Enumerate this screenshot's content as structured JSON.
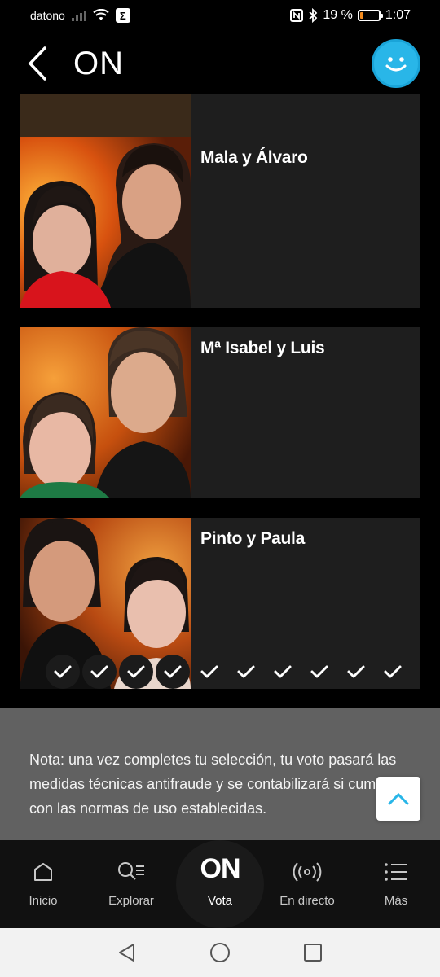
{
  "status_bar": {
    "carrier": "datono",
    "battery_percent": "19 %",
    "battery_level": 0.19,
    "time": "1:07"
  },
  "header": {
    "title": "ON",
    "back_icon": "chevron-left-icon",
    "avatar_icon": "smiley-icon"
  },
  "couples": [
    {
      "name": "Mala y Álvaro"
    },
    {
      "name": "Mª Isabel y Luis"
    },
    {
      "name": "Pinto y Paula"
    }
  ],
  "vote_checks": {
    "total": 10,
    "selected": 4
  },
  "note": {
    "text": "Nota: una vez completes tu selección, tu voto pasará las medidas técnicas antifraude y se contabilizará si cumple con las normas de uso establecidas."
  },
  "bottom_nav": {
    "inicio": "Inicio",
    "explorar": "Explorar",
    "vota_logo": "ON",
    "vota": "Vota",
    "en_directo": "En directo",
    "mas": "Más"
  },
  "colors": {
    "accent": "#29b6e8",
    "card_bg": "#1e1e1e",
    "note_bg": "#616161"
  }
}
